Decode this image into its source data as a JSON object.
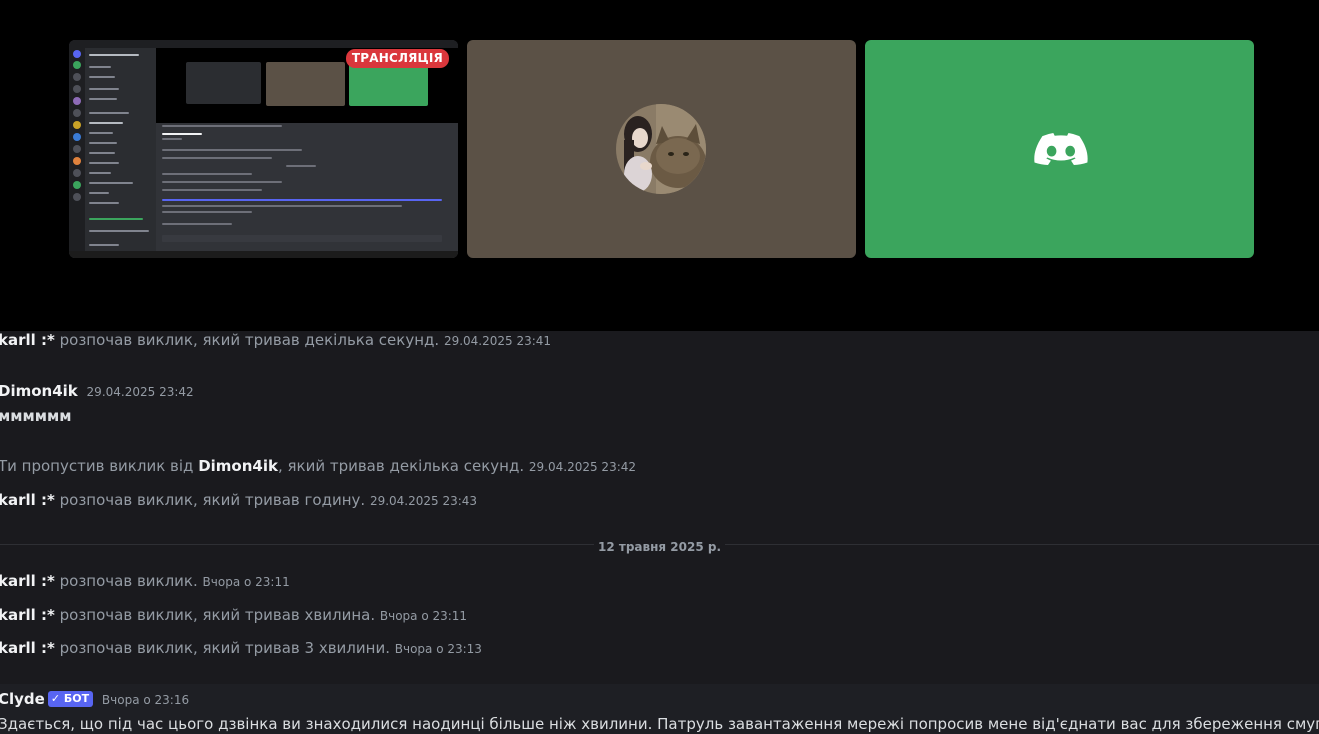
{
  "stream": {
    "live_label": "ТРАНСЛЯЦІЯ"
  },
  "tiles": {
    "user_avatar": "avatar-girl-cat",
    "discord_tile_icon": "discord-logo-icon",
    "discord_tile_color": "#3ba55d"
  },
  "chat": {
    "messages": [
      {
        "author": "karll :*",
        "text": "розпочав виклик, який тривав декілька секунд.",
        "time": "29.04.2025 23:41"
      },
      {
        "author": "Dimon4ik",
        "time": "29.04.2025 23:42",
        "body": "мммммм"
      },
      {
        "prefix": "Ти пропустив виклик від",
        "author": "Dimon4ik",
        "suffix": ", який тривав декілька секунд.",
        "time": "29.04.2025 23:42"
      },
      {
        "author": "karll :*",
        "text": "розпочав виклик, який тривав годину.",
        "time": "29.04.2025 23:43"
      },
      {
        "author": "karll :*",
        "text": "розпочав виклик.",
        "time": "Вчора о 23:11"
      },
      {
        "author": "karll :*",
        "text": "розпочав виклик, який тривав хвилина.",
        "time": "Вчора о 23:11"
      },
      {
        "author": "karll :*",
        "text": "розпочав виклик, який тривав 3 хвилини.",
        "time": "Вчора о 23:13"
      }
    ],
    "date_divider": "12 травня 2025 р.",
    "clyde": {
      "author": "Clyde",
      "badge": "БОТ",
      "time": "Вчора о 23:16",
      "body": "Здається, що під час цього дзвінка ви знаходилися наодинці більше ніж хвилини. Патруль завантаження мережі попросив мене від'єднати вас для збереження смуги"
    }
  },
  "colors": {
    "live_badge": "#da373c",
    "bot_badge": "#5865f2",
    "background": "#1a1a1e"
  }
}
